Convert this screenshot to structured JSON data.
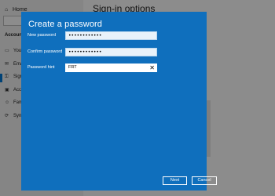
{
  "background": {
    "home_label": "Home",
    "section_label": "Accounts",
    "sidebar_items": [
      {
        "label": "Your info",
        "icon": "person-card-icon"
      },
      {
        "label": "Email & app accounts",
        "icon": "mail-icon"
      },
      {
        "label": "Sign-in options",
        "icon": "key-icon"
      },
      {
        "label": "Access work or school",
        "icon": "briefcase-icon"
      },
      {
        "label": "Family & other users",
        "icon": "people-icon"
      },
      {
        "label": "Sync your settings",
        "icon": "sync-icon"
      }
    ],
    "page_title": "Sign-in options"
  },
  "dialog": {
    "title": "Create a password",
    "new_password": {
      "label": "New password",
      "value": "••••••••••••"
    },
    "confirm_password": {
      "label": "Confirm password",
      "value": "••••••••••••"
    },
    "password_hint": {
      "label": "Password hint",
      "value": "FRT"
    },
    "next_label": "Next",
    "cancel_label": "Cancel"
  },
  "colors": {
    "dialog_bg": "#0f6fbd",
    "accent": "#0078d7"
  }
}
